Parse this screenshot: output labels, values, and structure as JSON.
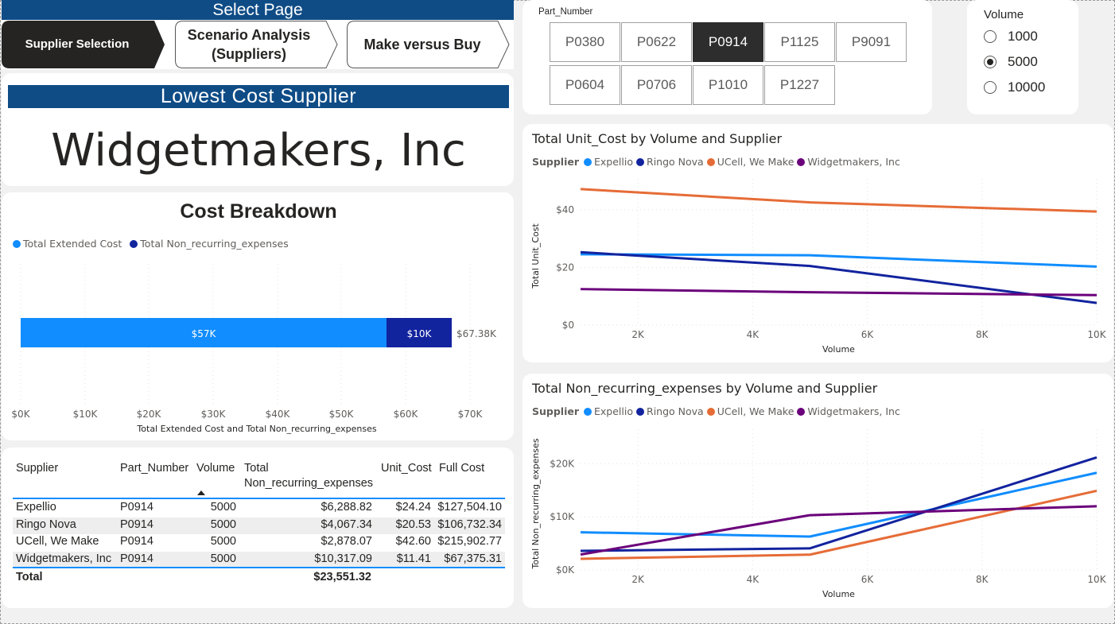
{
  "nav": {
    "title": "Select Page",
    "buttons": [
      {
        "label": "Supplier Selection",
        "active": true
      },
      {
        "label": "Scenario Analysis (Suppliers)",
        "line1": "Scenario Analysis",
        "line2": "(Suppliers)",
        "active": false
      },
      {
        "label": "Make versus Buy",
        "active": false
      }
    ]
  },
  "lowest": {
    "title": "Lowest Cost Supplier",
    "supplier": "Widgetmakers, Inc"
  },
  "breakdown": {
    "title": "Cost Breakdown",
    "legend": [
      "Total Extended Cost",
      "Total Non_recurring_expenses"
    ],
    "colors": [
      "#118dff",
      "#12239e"
    ],
    "extended_label": "$57K",
    "nre_label": "$10K",
    "total_label": "$67.38K",
    "xlabel": "Total Extended Cost and Total Non_recurring_expenses",
    "ticks": [
      "$0K",
      "$10K",
      "$20K",
      "$30K",
      "$40K",
      "$50K",
      "$60K",
      "$70K"
    ]
  },
  "table": {
    "headers": [
      "Supplier",
      "Part_Number",
      "Volume",
      "Total",
      "Non_recurring_expenses",
      "Unit_Cost",
      "Full Cost"
    ],
    "rows": [
      [
        "Expellio",
        "P0914",
        "5000",
        "$6,288.82",
        "$24.24",
        "$127,504.10"
      ],
      [
        "Ringo Nova",
        "P0914",
        "5000",
        "$4,067.34",
        "$20.53",
        "$106,732.34"
      ],
      [
        "UCell, We Make",
        "P0914",
        "5000",
        "$2,878.07",
        "$42.60",
        "$215,902.77"
      ],
      [
        "Widgetmakers, Inc",
        "P0914",
        "5000",
        "$10,317.09",
        "$11.41",
        "$67,375.31"
      ]
    ],
    "total_label": "Total",
    "total_nre": "$23,551.32"
  },
  "part_slicer": {
    "label": "Part_Number",
    "options": [
      "P0380",
      "P0622",
      "P0914",
      "P1125",
      "P9091",
      "P0604",
      "P0706",
      "P1010",
      "P1227"
    ],
    "selected": "P0914"
  },
  "volume_slicer": {
    "title": "Volume",
    "options": [
      "1000",
      "5000",
      "10000"
    ],
    "selected": "5000"
  },
  "chart_data": [
    {
      "type": "line",
      "title": "Total Unit_Cost by Volume and Supplier",
      "legend_title": "Supplier",
      "xlabel": "Volume",
      "ylabel": "Total Unit_Cost",
      "x": [
        1000,
        5000,
        10000
      ],
      "xlim": [
        1000,
        10000
      ],
      "ylim": [
        0,
        48
      ],
      "x_ticks": [
        "2K",
        "4K",
        "6K",
        "8K",
        "10K"
      ],
      "y_ticks": [
        "$0",
        "$20",
        "$40"
      ],
      "series": [
        {
          "name": "Expellio",
          "color": "#118dff",
          "values": [
            24.6,
            24.24,
            20.3
          ]
        },
        {
          "name": "Ringo Nova",
          "color": "#12239e",
          "values": [
            25.3,
            20.53,
            7.7
          ]
        },
        {
          "name": "UCell, We Make",
          "color": "#e66c37",
          "values": [
            47.2,
            42.6,
            39.4
          ]
        },
        {
          "name": "Widgetmakers, Inc",
          "color": "#6b007b",
          "values": [
            12.5,
            11.41,
            10.4
          ]
        }
      ]
    },
    {
      "type": "line",
      "title": "Total Non_recurring_expenses by Volume and Supplier",
      "legend_title": "Supplier",
      "xlabel": "Volume",
      "ylabel": "Total Non_recurring_expenses",
      "x": [
        1000,
        5000,
        10000
      ],
      "xlim": [
        1000,
        10000
      ],
      "ylim": [
        0,
        25000
      ],
      "x_ticks": [
        "2K",
        "4K",
        "6K",
        "8K",
        "10K"
      ],
      "y_ticks": [
        "$0K",
        "$10K",
        "$20K"
      ],
      "series": [
        {
          "name": "Expellio",
          "color": "#118dff",
          "values": [
            7100,
            6288.82,
            18300
          ]
        },
        {
          "name": "Ringo Nova",
          "color": "#12239e",
          "values": [
            3600,
            4067.34,
            21200
          ]
        },
        {
          "name": "UCell, We Make",
          "color": "#e66c37",
          "values": [
            2100,
            2878.07,
            14900
          ]
        },
        {
          "name": "Widgetmakers, Inc",
          "color": "#6b007b",
          "values": [
            2900,
            10317.09,
            12000
          ]
        }
      ]
    }
  ]
}
